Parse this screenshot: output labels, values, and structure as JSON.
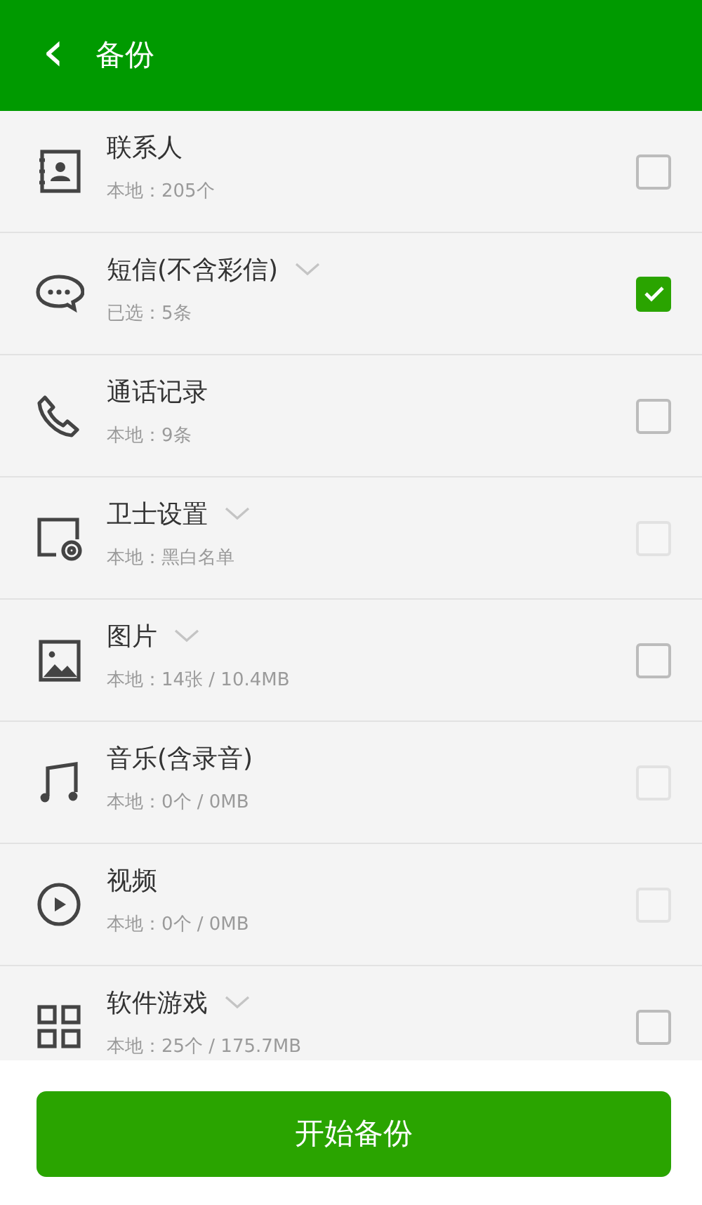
{
  "header": {
    "back": "‹",
    "title": "备份"
  },
  "items": [
    {
      "title": "联系人",
      "subtitle": "本地：205个",
      "expandable": false,
      "checked": false,
      "disabled": false
    },
    {
      "title": "短信(不含彩信)",
      "subtitle": "已选：5条",
      "expandable": true,
      "checked": true,
      "disabled": false
    },
    {
      "title": "通话记录",
      "subtitle": "本地：9条",
      "expandable": false,
      "checked": false,
      "disabled": false
    },
    {
      "title": "卫士设置",
      "subtitle": "本地：黑白名单",
      "expandable": true,
      "checked": false,
      "disabled": true
    },
    {
      "title": "图片",
      "subtitle": "本地：14张 / 10.4MB",
      "expandable": true,
      "checked": false,
      "disabled": false
    },
    {
      "title": "音乐(含录音)",
      "subtitle": "本地：0个 / 0MB",
      "expandable": false,
      "checked": false,
      "disabled": true
    },
    {
      "title": "视频",
      "subtitle": "本地：0个 / 0MB",
      "expandable": false,
      "checked": false,
      "disabled": true
    },
    {
      "title": "软件游戏",
      "subtitle": "本地：25个 / 175.7MB",
      "expandable": true,
      "checked": false,
      "disabled": false
    }
  ],
  "button": "开始备份"
}
